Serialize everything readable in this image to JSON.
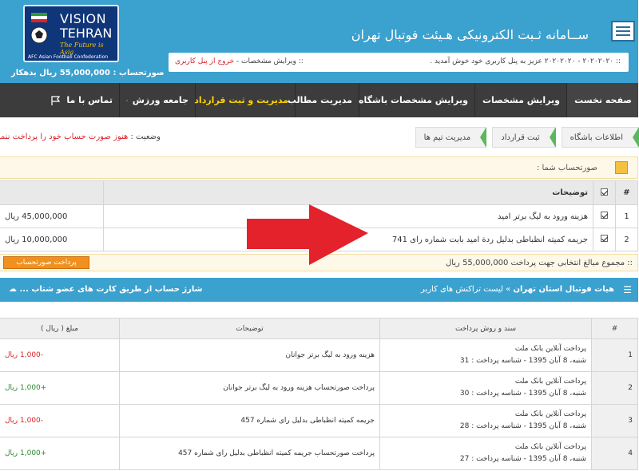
{
  "header": {
    "site_title": "ســامانه ثـبت الکترونیکی هـیئت فوتبال تهران",
    "logo": {
      "line1": "VISION",
      "line2": "TEHRAN",
      "tagline": "The Future is Asia",
      "afc": "AFC Asian Football Confederation"
    },
    "balance_text": "صورتحساب : 55,000,000 ریال بدهکار",
    "welcome_text": ":: ۲۰۲۰۲۰۲۰ - ۲۰۲۰۲۰۲۰ عزیز به پنل کاربری خود خوش آمدید .",
    "links_prefix": ":: ویرایش مشخصات - ",
    "logout_text": "خروج از پنل کاربری"
  },
  "nav": {
    "items": [
      {
        "label": "صفحه نخست"
      },
      {
        "label": "ویرایش مشخصات"
      },
      {
        "label": "ویرایش مشخصات باشگاه"
      },
      {
        "label": "مدیریت مطالب"
      },
      {
        "label": "مدیریت و ثبت قرارداد"
      },
      {
        "label": "جامعه ورزش"
      },
      {
        "label": "تماس با ما"
      }
    ]
  },
  "breadcrumbs": [
    "اطلاعات باشگاه",
    "ثبت قرارداد",
    "مدیریت تیم ها"
  ],
  "status": {
    "label": "وضعیت :",
    "value": "هنوز صورت حساب خود را پرداخت ننموده اید"
  },
  "invoice": {
    "title": "صورتحساب شما :",
    "columns": [
      "#",
      "توضیحات"
    ],
    "rows": [
      {
        "n": "1",
        "desc": "هزینه ورود به لیگ برتر امید",
        "amount": "45,000,000 ریال"
      },
      {
        "n": "2",
        "desc": "جریمه کمیته انظباطی بدلیل ردة امید بابت شماره رای 741",
        "amount": "10,000,000 ریال"
      }
    ],
    "total_text": ":: مجموع مبالغ انتخابی جهت پرداخت 55,000,000 ریال",
    "pay_button": "پرداخت صورتحساب"
  },
  "transactions": {
    "breadcrumb_root": "هیات فوتبال استان تهران",
    "breadcrumb_sep": "»",
    "breadcrumb_page": "لیست تراکنش های کاربر",
    "charge_text": "شارژ حساب از طریق کارت های عضو شتاب ...",
    "columns": [
      "#",
      "سند و روش پرداخت",
      "توضیحات",
      "مبلغ ( ریال )"
    ],
    "rows": [
      {
        "n": "1",
        "method": "پرداخت آنلاین بانک ملت",
        "date": "شنبه، 8 آبان 1395 - شناسه پرداخت : 31",
        "desc": "هزینه ورود به لیگ برتر جوانان",
        "amount": "-1,000 ریال",
        "sign": "neg"
      },
      {
        "n": "2",
        "method": "پرداخت آنلاین بانک ملت",
        "date": "شنبه، 8 آبان 1395 - شناسه پرداخت : 30",
        "desc": "پرداخت صورتحساب هزینه ورود به لیگ برتر جوانان",
        "amount": "+1,000 ریال",
        "sign": "pos"
      },
      {
        "n": "3",
        "method": "پرداخت آنلاین بانک ملت",
        "date": "شنبه، 8 آبان 1395 - شناسه پرداخت : 28",
        "desc": "جریمه کمیته انظباطی بدلیل رای شماره 457",
        "amount": "-1,000 ریال",
        "sign": "neg"
      },
      {
        "n": "4",
        "method": "پرداخت آنلاین بانک ملت",
        "date": "شنبه، 8 آبان 1395 - شناسه پرداخت : 27",
        "desc": "پرداخت صورتحساب جریمه کمیته انظباطی بدلیل رای شماره 457",
        "amount": "+1,000 ریال",
        "sign": "pos"
      }
    ]
  },
  "colors": {
    "header_blue": "#3ba1cf",
    "nav_bg": "#3c3c3c",
    "active_nav": "#ffd400",
    "arrow_red": "#e3222b",
    "pay_orange": "#f0901e"
  }
}
